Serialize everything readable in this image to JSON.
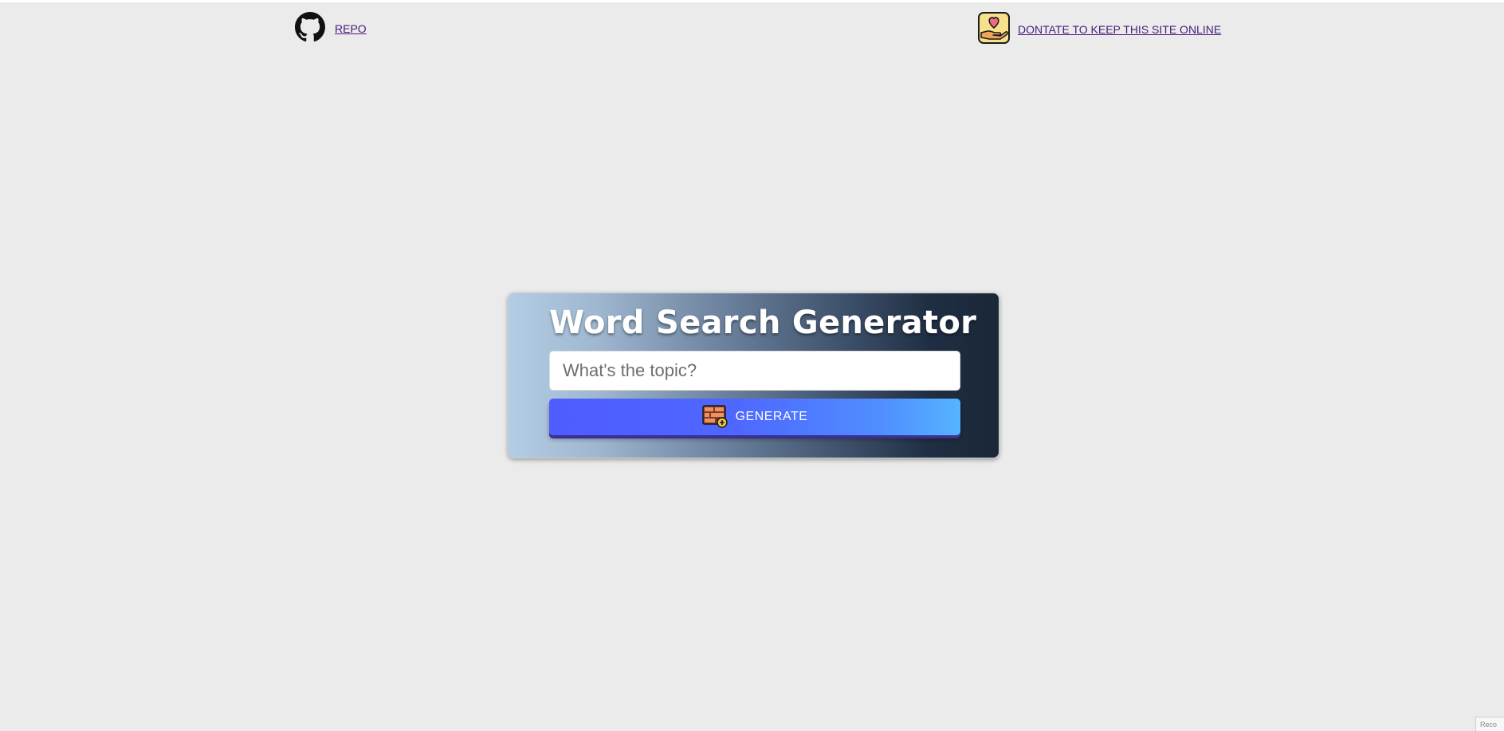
{
  "nav": {
    "repo": {
      "label": "REPO",
      "icon": "github-icon"
    },
    "donate": {
      "label": "DONTATE TO KEEP THIS SITE ONLINE",
      "icon": "donate-heart-hand-icon"
    }
  },
  "card": {
    "title": "Word Search Generator",
    "input": {
      "placeholder": "What's the topic?",
      "value": ""
    },
    "generate_button": {
      "label": "GENERATE",
      "icon": "puzzle-grid-add-icon"
    }
  },
  "corner_badge": {
    "text": "Reco"
  },
  "colors": {
    "background": "#eaebea",
    "link": "#4b1a7e",
    "button_start": "#4f5cff",
    "button_end": "#55b4ff",
    "card_start": "#b3cde4",
    "card_end": "#1a2738"
  }
}
